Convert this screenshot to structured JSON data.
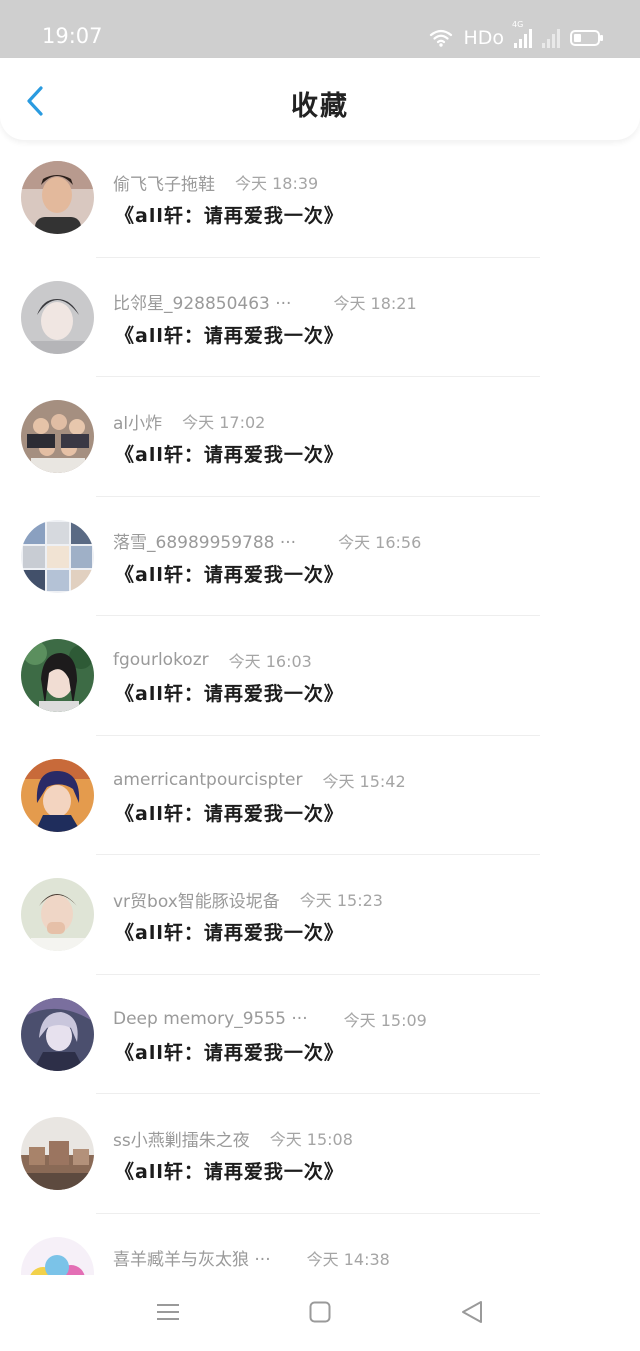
{
  "status_bar": {
    "time": "19:07",
    "hd": "HDo",
    "network": "4G"
  },
  "header": {
    "title": "收藏"
  },
  "colors": {
    "accent": "#2a9be0",
    "status_bar_bg": "#cfcfcf"
  },
  "icons": {
    "back": "chevron-left-icon",
    "wifi": "wifi-icon",
    "signal": "signal-icon",
    "battery": "battery-icon",
    "nav_menu": "menu-icon",
    "nav_home": "home-square-icon",
    "nav_back": "back-triangle-icon"
  },
  "items": [
    {
      "user": "偷飞飞子拖鞋",
      "time": "今天 18:39",
      "content": "《all轩：请再爱我一次》"
    },
    {
      "user": "比邻星_928850463 ···",
      "time": "今天 18:21",
      "content": "《all轩：请再爱我一次》"
    },
    {
      "user": "al小炸",
      "time": "今天 17:02",
      "content": "《all轩：请再爱我一次》"
    },
    {
      "user": "落雪_68989959788 ···",
      "time": "今天 16:56",
      "content": "《all轩：请再爱我一次》"
    },
    {
      "user": "fgourlokozr",
      "time": "今天 16:03",
      "content": "《all轩：请再爱我一次》"
    },
    {
      "user": "amerricantpourcispter",
      "time": "今天 15:42",
      "content": "《all轩：请再爱我一次》"
    },
    {
      "user": "vr贸box智能豚设坭备",
      "time": "今天 15:23",
      "content": "《all轩：请再爱我一次》"
    },
    {
      "user": "Deep memory_9555 ···",
      "time": "今天 15:09",
      "content": "《all轩：请再爱我一次》"
    },
    {
      "user": "ss小燕剿擂朱之夜",
      "time": "今天 15:08",
      "content": "《all轩：请再爱我一次》"
    },
    {
      "user": "喜羊臧羊与灰太狼 ···",
      "time": "今天 14:38",
      "content": ""
    }
  ]
}
